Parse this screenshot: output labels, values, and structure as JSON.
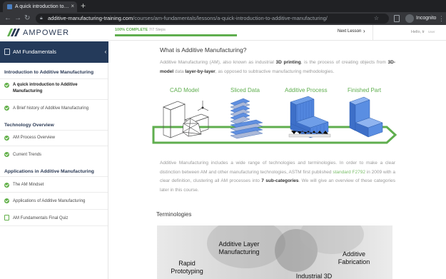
{
  "browser": {
    "tab_title": "A quick introduction to Additive",
    "tab_close": "×",
    "new_tab": "+",
    "url_host": "additive-manufacturing-training.com",
    "url_path": "/courses/am-fundamentals/lessons/a-quick-introduction-to-additive-manufacturing/",
    "profile_label": "Incognito",
    "nav_back": "←",
    "nav_forward": "→",
    "nav_reload": "↻"
  },
  "header": {
    "brand": "AMPOWER",
    "progress_complete": "100% COMPLETE",
    "progress_steps": "7/7 Steps",
    "progress_percent": 100,
    "next_lesson": "Next Lesson",
    "next_arrow": "›",
    "greeting": "Hello, tr",
    "avatar_alt": "User"
  },
  "sidebar": {
    "course_title": "AM Fundamentals",
    "collapse": "‹",
    "sections": [
      {
        "title": "Introduction to Additive Manufacturing",
        "lessons": [
          {
            "label_1": "A quick introduction to Additive",
            "label_2": "Manufacturing"
          },
          {
            "label": "A Brief history of Additive Manufacturing"
          }
        ]
      },
      {
        "title": "Technology Overview",
        "lessons": [
          {
            "label": "AM Process Overview"
          },
          {
            "label": "Current Trends"
          }
        ]
      },
      {
        "title": "Applications in Additive Manufacturing",
        "lessons": [
          {
            "label": "The AM Mindset"
          },
          {
            "label": "Applications of Additive Manufacturing"
          },
          {
            "label": "AM Fundamentals Final Quiz"
          }
        ]
      }
    ]
  },
  "main": {
    "heading": "What is Additive Manufacturing?",
    "intro": {
      "t1": "Additive Manufacturing (AM), also known as industrial ",
      "b1": "3D printing",
      "t2": ", is the process of creating objects from ",
      "b2": "3D-model",
      "t3": " data ",
      "b3": "layer-by-layer",
      "t4": ", as opposed to subtractive manufacturing methodologies."
    },
    "diagram": {
      "labels": [
        "CAD Model",
        "Sliced Data",
        "Additive Process",
        "Finished Part"
      ],
      "accent": "#5fae4e",
      "part_color": "#4f86e0"
    },
    "body": {
      "t1": "Additive Manufacturing includes a wide range of technologies and terminologies. In order to make a clear distinction between AM and other manufacturing technologies, ASTM first published ",
      "link": "standard F2792",
      "t2": " in 2009 with a clear definition, clustering all AM processes into ",
      "b1": "7 sub-categories",
      "t3": ". We will give an overview of these categories later in this course."
    },
    "terminologies_heading": "Terminologies",
    "photo_labels": {
      "rapid": [
        "Rapid",
        "Prototyping"
      ],
      "alm": [
        "Additive Layer",
        "Manufacturing"
      ],
      "af": [
        "Additive",
        "Fabrication"
      ],
      "i3d": [
        "Industrial 3D"
      ]
    }
  }
}
